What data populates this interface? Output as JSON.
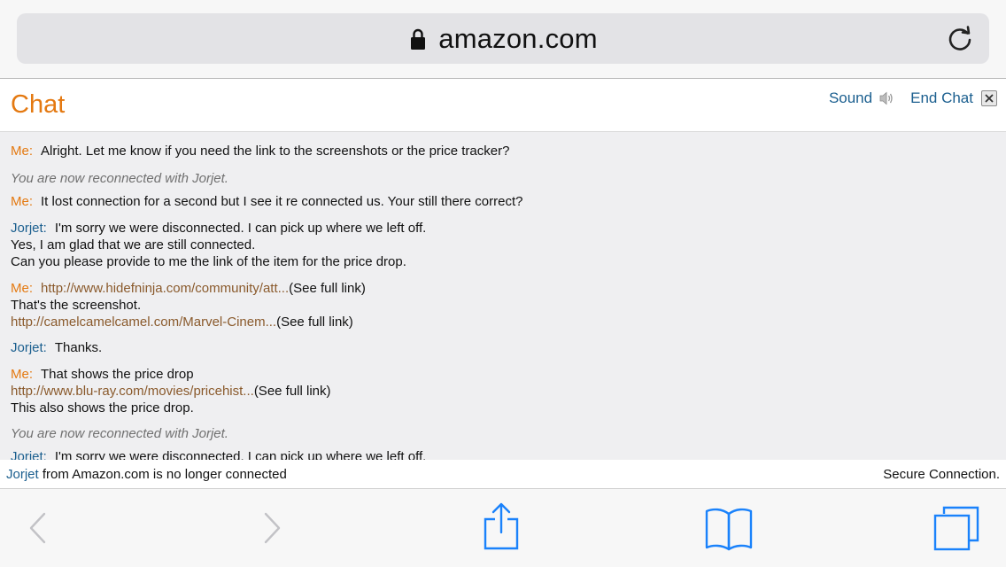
{
  "browser": {
    "url": "amazon.com"
  },
  "chat": {
    "title": "Chat",
    "sound_label": "Sound",
    "end_chat_label": "End Chat"
  },
  "messages": [
    {
      "who": "Me:",
      "lines": [
        "Alright. Let me know if you need the link to the screenshots or the price tracker?"
      ]
    },
    {
      "system": "You are now reconnected with Jorjet."
    },
    {
      "who": "Me:",
      "lines": [
        "It lost connection for a second but I see it re connected us. Your still there correct?"
      ]
    },
    {
      "who": "Jorjet:",
      "lines": [
        "I'm sorry we were disconnected. I can pick up where we left off.",
        "Yes, I am glad that we are still connected.",
        "Can you please provide to me the link of the item for the price drop."
      ]
    },
    {
      "who": "Me:",
      "link1": "http://www.hidefninja.com/community/att...",
      "link1_suffix": "(See full link)",
      "line2": "That's the screenshot.",
      "link2": "http://camelcamelcamel.com/Marvel-Cinem...",
      "link2_suffix": "(See full link)"
    },
    {
      "who": "Jorjet:",
      "lines": [
        "Thanks."
      ]
    },
    {
      "who": "Me:",
      "line1": "That shows the price drop",
      "link": "http://www.blu-ray.com/movies/pricehist...",
      "link_suffix": "(See full link)",
      "line3": "This also shows the price drop."
    },
    {
      "system": "You are now reconnected with Jorjet."
    },
    {
      "who": "Jorjet:",
      "lines": [
        "I'm sorry we were disconnected. I can pick up where we left off."
      ]
    }
  ],
  "status": {
    "agent_name": "Jorjet",
    "disconnect_text": " from Amazon.com is no longer connected",
    "secure_text": "Secure Connection."
  },
  "icons": {
    "lock": "lock-icon",
    "reload": "reload-icon",
    "speaker": "speaker-icon",
    "close": "close-icon",
    "back": "chevron-left-icon",
    "forward": "chevron-right-icon",
    "share": "share-icon",
    "bookmarks": "book-icon",
    "tabs": "tabs-icon"
  },
  "colors": {
    "accent_orange": "#e47911",
    "agent_blue": "#1b5f8f",
    "link_brown": "#8a5a2c",
    "ios_blue": "#1a82fb"
  }
}
